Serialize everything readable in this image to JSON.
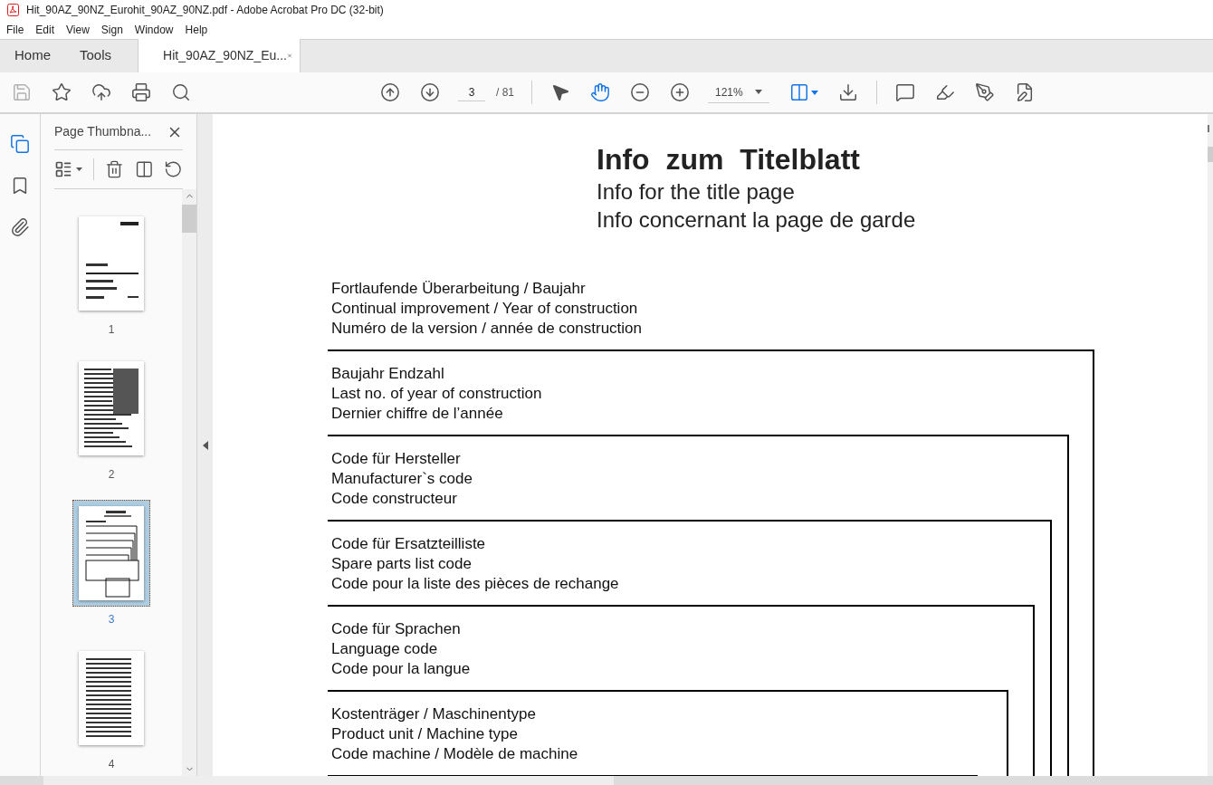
{
  "window": {
    "title": "Hit_90AZ_90NZ_Eurohit_90AZ_90NZ.pdf - Adobe Acrobat Pro DC (32-bit)"
  },
  "menu": [
    "File",
    "Edit",
    "View",
    "Sign",
    "Window",
    "Help"
  ],
  "tabs": [
    {
      "label": "Home",
      "selected": false
    },
    {
      "label": "Tools",
      "selected": false
    },
    {
      "label": "Hit_90AZ_90NZ_Eu...",
      "selected": true
    }
  ],
  "toolbar": {
    "page": "3",
    "page_of": "/ 81",
    "zoom": "121%"
  },
  "panel": {
    "title": "Page Thumbna...",
    "thumbnails": [
      {
        "label": "1",
        "selected": false
      },
      {
        "label": "2",
        "selected": false
      },
      {
        "label": "3",
        "selected": true
      },
      {
        "label": "4",
        "selected": false
      }
    ]
  },
  "document": {
    "title": "Info  zum  Titelblatt",
    "subtitles": [
      "Info for the title page",
      "Info concernant la page de garde"
    ],
    "sections": [
      [
        "Fortlaufende Überarbeitung / Baujahr",
        "Continual improvement / Year of construction",
        "Numéro de la version / année de construction"
      ],
      [
        "Baujahr Endzahl",
        "Last no. of year of construction",
        "Dernier chiffre de l’année"
      ],
      [
        "Code für Hersteller",
        "Manufacturer`s  code",
        "Code constructeur"
      ],
      [
        "Code für Ersatzteilliste",
        "Spare parts list code",
        "Code pour la liste des pièces de rechange"
      ],
      [
        "Code für Sprachen",
        "Language code",
        "Code pour la langue"
      ],
      [
        "Kostenträger / Maschinentype",
        "Product unit / Machine type",
        "Code machine / Modèle de machine"
      ]
    ]
  }
}
